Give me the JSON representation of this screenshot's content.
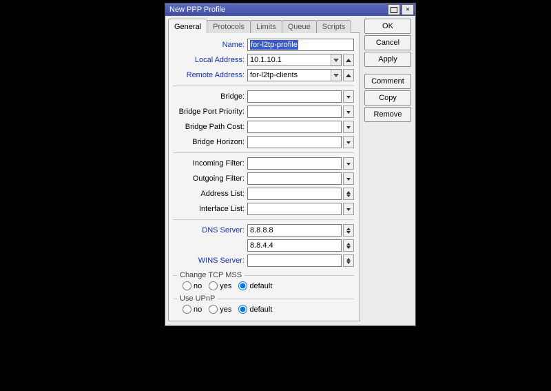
{
  "window": {
    "title": "New PPP Profile"
  },
  "tabs": {
    "general": "General",
    "protocols": "Protocols",
    "limits": "Limits",
    "queue": "Queue",
    "scripts": "Scripts"
  },
  "buttons": {
    "ok": "OK",
    "cancel": "Cancel",
    "apply": "Apply",
    "comment": "Comment",
    "copy": "Copy",
    "remove": "Remove"
  },
  "labels": {
    "name": "Name:",
    "local_address": "Local Address:",
    "remote_address": "Remote Address:",
    "bridge": "Bridge:",
    "bridge_port_priority": "Bridge Port Priority:",
    "bridge_path_cost": "Bridge Path Cost:",
    "bridge_horizon": "Bridge Horizon:",
    "incoming_filter": "Incoming Filter:",
    "outgoing_filter": "Outgoing Filter:",
    "address_list": "Address List:",
    "interface_list": "Interface List:",
    "dns_server": "DNS Server:",
    "wins_server": "WINS Server:",
    "change_tcp_mss": "Change TCP MSS",
    "use_upnp": "Use UPnP"
  },
  "radio_options": {
    "no": "no",
    "yes": "yes",
    "default": "default"
  },
  "values": {
    "name": "for-l2tp-profile",
    "local_address": "10.1.10.1",
    "remote_address": "for-l2tp-clients",
    "bridge": "",
    "bridge_port_priority": "",
    "bridge_path_cost": "",
    "bridge_horizon": "",
    "incoming_filter": "",
    "outgoing_filter": "",
    "address_list": "",
    "interface_list": "",
    "dns_server_1": "8.8.8.8",
    "dns_server_2": "8.8.4.4",
    "wins_server": "",
    "change_tcp_mss": "default",
    "use_upnp": "default"
  }
}
